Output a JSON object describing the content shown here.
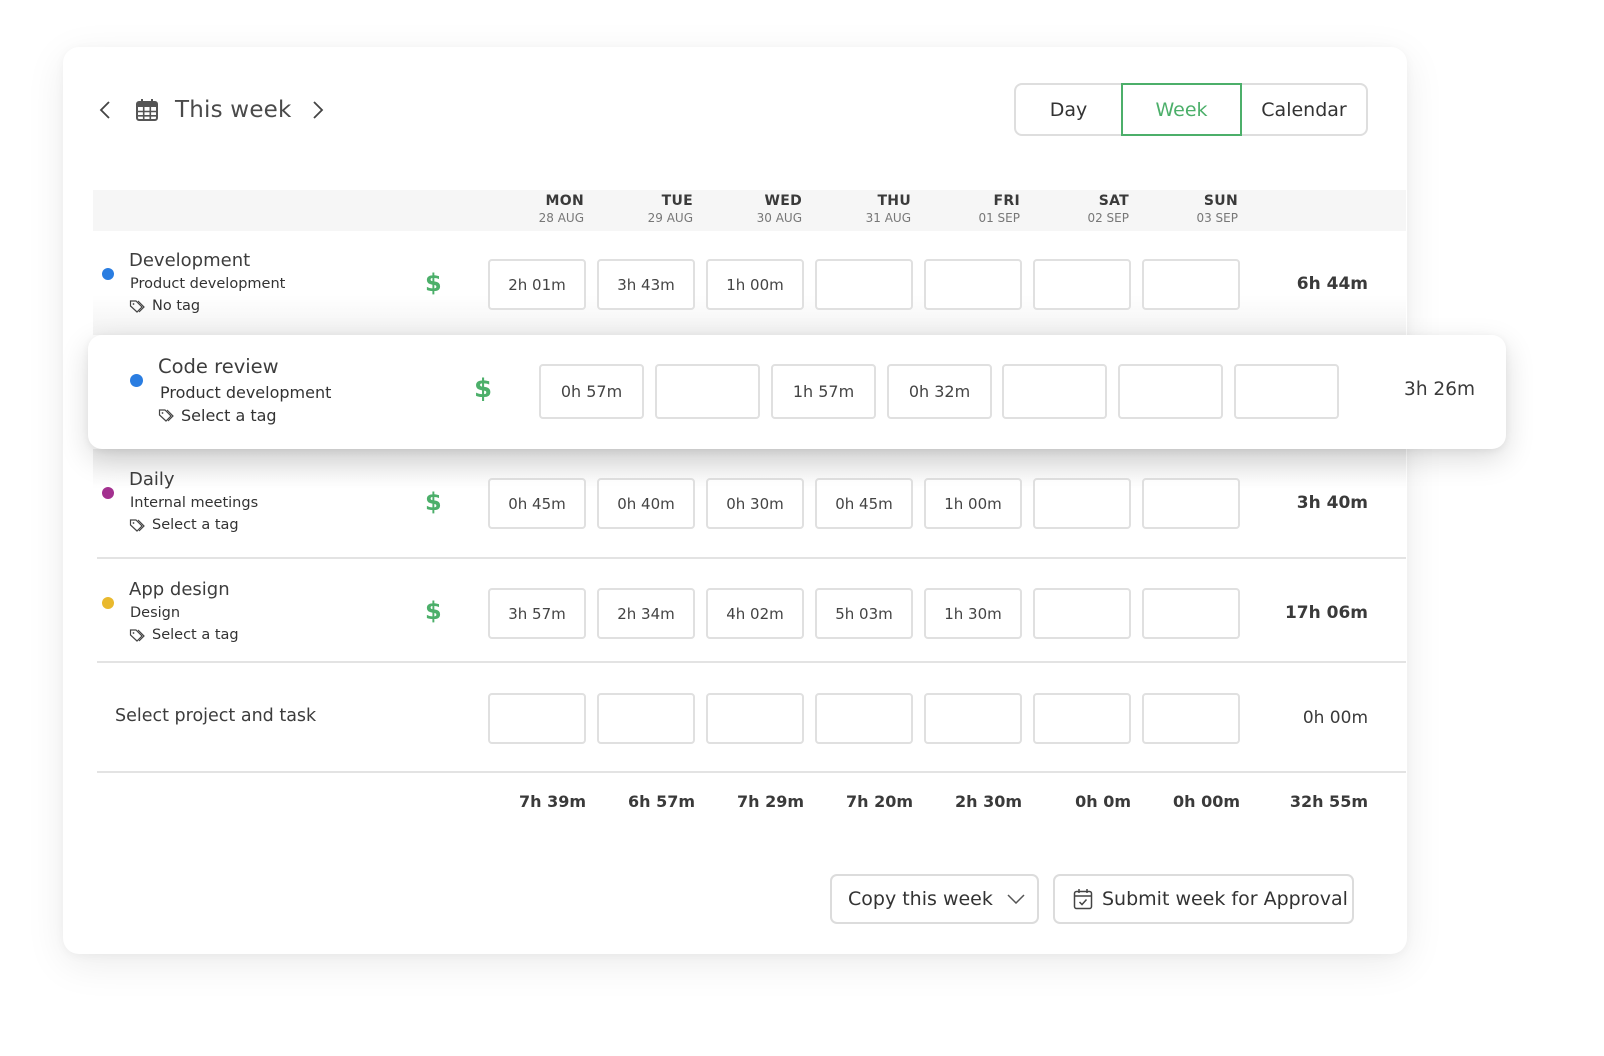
{
  "header": {
    "title": "This week",
    "prev_icon": "chevron-left-icon",
    "next_icon": "chevron-right-icon",
    "calendar_icon": "calendar-icon"
  },
  "view_switch": {
    "options": [
      "Day",
      "Week",
      "Calendar"
    ],
    "selected": "Week",
    "accent_color": "#4caf6a"
  },
  "columns": [
    {
      "day": "MON",
      "date": "28 AUG"
    },
    {
      "day": "TUE",
      "date": "29 AUG"
    },
    {
      "day": "WED",
      "date": "30 AUG"
    },
    {
      "day": "THU",
      "date": "31 AUG"
    },
    {
      "day": "FRI",
      "date": "01 SEP"
    },
    {
      "day": "SAT",
      "date": "02 SEP"
    },
    {
      "day": "SUN",
      "date": "03 SEP"
    }
  ],
  "rows": [
    {
      "task": "Development",
      "project": "Product development",
      "tag": "No tag",
      "color": "#2a7de1",
      "billable": "$",
      "entries": [
        "2h 01m",
        "3h 43m",
        "1h 00m",
        "",
        "",
        "",
        ""
      ],
      "total": "6h 44m"
    },
    {
      "task": "Code review",
      "project": "Product development",
      "tag": "Select a tag",
      "color": "#2a7de1",
      "billable": "$",
      "entries": [
        "0h 57m",
        "",
        "1h 57m",
        "0h 32m",
        "",
        "",
        ""
      ],
      "total": "3h 26m",
      "elevated": true
    },
    {
      "task": "Daily",
      "project": "Internal meetings",
      "tag": "Select a tag",
      "color": "#a3308f",
      "billable": "$",
      "entries": [
        "0h 45m",
        "0h 40m",
        "0h 30m",
        "0h 45m",
        "1h 00m",
        "",
        ""
      ],
      "total": "3h 40m"
    },
    {
      "task": "App design",
      "project": "Design",
      "tag": "Select a tag",
      "color": "#e9b92e",
      "billable": "$",
      "entries": [
        "3h 57m",
        "2h 34m",
        "4h 02m",
        "5h 03m",
        "1h 30m",
        "",
        ""
      ],
      "total": "17h 06m"
    }
  ],
  "new_row": {
    "label": "Select project and task",
    "entries": [
      "",
      "",
      "",
      "",
      "",
      "",
      ""
    ],
    "total": "0h 00m"
  },
  "column_totals": [
    "7h 39m",
    "6h 57m",
    "7h 29m",
    "7h 20m",
    "2h 30m",
    "0h 0m",
    "0h 00m"
  ],
  "grand_total": "32h 55m",
  "footer": {
    "copy_label": "Copy this week",
    "submit_label": "Submit week for Approval"
  }
}
